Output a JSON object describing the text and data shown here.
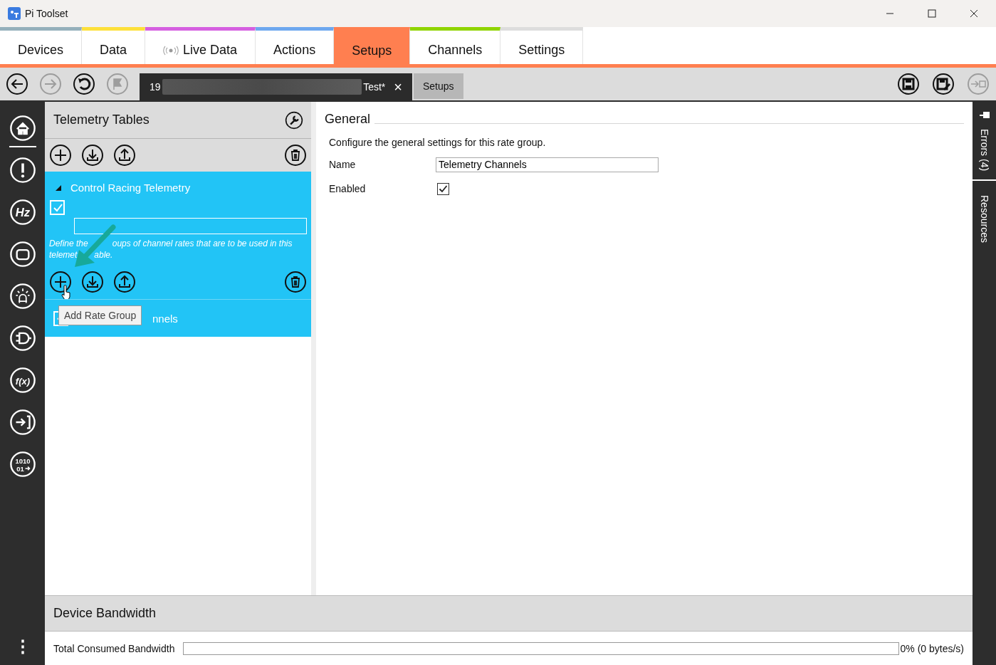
{
  "window": {
    "title": "Pi Toolset"
  },
  "tabs": [
    {
      "label": "Devices",
      "color": "#95b0bb",
      "selected": false,
      "kind": "plain"
    },
    {
      "label": "Data",
      "color": "#fde03a",
      "selected": false,
      "kind": "plain"
    },
    {
      "label": "Live Data",
      "color": "#d55fe0",
      "selected": false,
      "kind": "live"
    },
    {
      "label": "Actions",
      "color": "#6ea8ef",
      "selected": false,
      "kind": "plain"
    },
    {
      "label": "Setups",
      "color": "#ff7f50",
      "selected": true,
      "kind": "plain"
    },
    {
      "label": "Channels",
      "color": "#8fd400",
      "selected": false,
      "kind": "plain"
    },
    {
      "label": "Settings",
      "color": "#dddddd",
      "selected": false,
      "kind": "plain"
    }
  ],
  "toolbar": {
    "left_buttons": [
      {
        "kind": "back",
        "disabled": false
      },
      {
        "kind": "forward",
        "disabled": true
      },
      {
        "kind": "undo",
        "disabled": false
      },
      {
        "kind": "redo",
        "disabled": true
      }
    ],
    "document_tab": {
      "title_start": "19",
      "title_end": "Test*",
      "close": "×"
    },
    "document_label": "Setups",
    "right_buttons": [
      {
        "kind": "save",
        "disabled": false
      },
      {
        "kind": "save-as",
        "disabled": false
      },
      {
        "kind": "exit",
        "disabled": true
      }
    ]
  },
  "rail": [
    {
      "kind": "home"
    },
    {
      "kind": "alert"
    },
    {
      "kind": "text",
      "label": "Hz"
    },
    {
      "kind": "device"
    },
    {
      "kind": "light"
    },
    {
      "kind": "plug"
    },
    {
      "kind": "text",
      "label": "f(x)"
    },
    {
      "kind": "import"
    },
    {
      "kind": "binary",
      "label": "1010",
      "label2": "01"
    }
  ],
  "panel": {
    "title": "Telemetry Tables",
    "tree": [
      {
        "label": "Control Racing Telemetry",
        "expanded": true,
        "checked": true,
        "description_lines": [
          [
            "Define the",
            "oups of channel rates that are to be used in this"
          ],
          [
            "telemet",
            "able."
          ]
        ],
        "children": [
          {
            "label": "nnels",
            "checked": true
          }
        ]
      }
    ],
    "tooltip": "Add Rate Group"
  },
  "general": {
    "heading": "General",
    "description": "Configure the general settings for this rate group.",
    "fields": [
      {
        "kind": "text",
        "label": "Name",
        "value": "Telemetry Channels"
      },
      {
        "kind": "checkbox",
        "label": "Enabled",
        "checked": true
      }
    ]
  },
  "side_tabs": [
    {
      "label": "Errors (4)"
    },
    {
      "label": "Resources"
    }
  ],
  "bandwidth": {
    "title": "Device Bandwidth",
    "label": "Total Consumed Bandwidth",
    "level": 0,
    "reading": "0% (0 bytes/s)"
  },
  "rail_more": "⋮"
}
